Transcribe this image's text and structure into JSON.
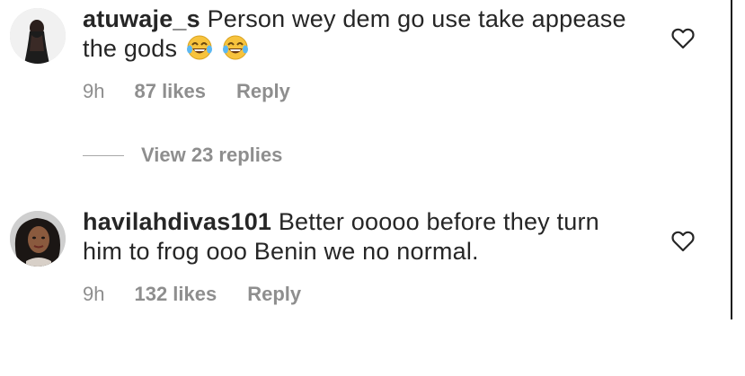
{
  "comments": [
    {
      "username": "atuwaje_s",
      "text": "Person wey dem go use take appease the gods",
      "emoji_icons": [
        "face-with-tears-of-joy-icon",
        "face-with-tears-of-joy-icon"
      ],
      "time": "9h",
      "likes": "87 likes",
      "reply_label": "Reply"
    },
    {
      "username": "havilahdivas101",
      "text": "Better ooooo before they turn him to frog ooo Benin we no normal.",
      "time": "9h",
      "likes": "132 likes",
      "reply_label": "Reply"
    }
  ],
  "view_replies": {
    "label": "View 23 replies"
  },
  "icons": {
    "like": "heart-outline-icon",
    "emoji": "face-with-tears-of-joy-icon"
  },
  "colors": {
    "text": "#262626",
    "secondary": "#8e8e8e",
    "divider": "#a8a8a8",
    "emoji_face": "#f7c33d"
  }
}
